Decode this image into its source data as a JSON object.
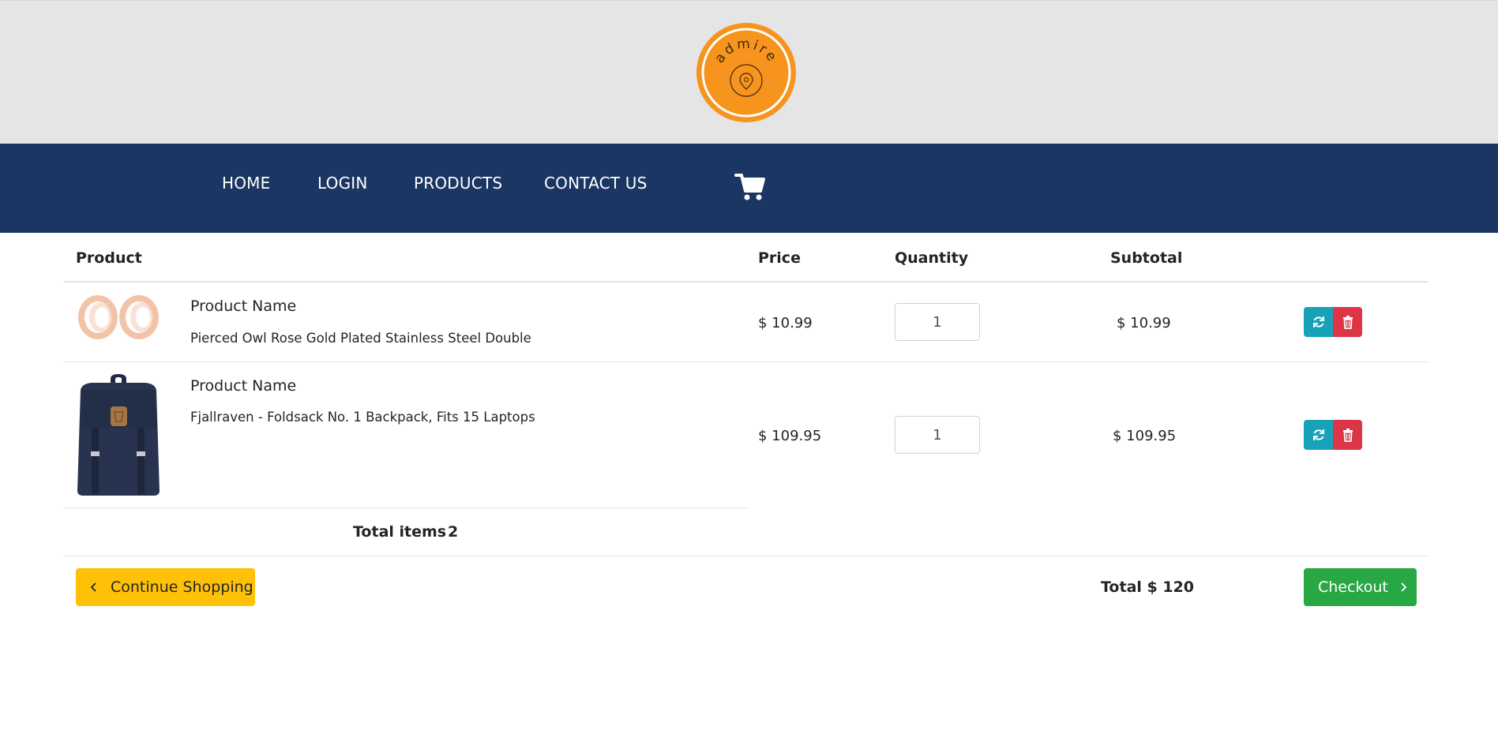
{
  "brand": {
    "logo_text": "admire"
  },
  "nav": {
    "items": [
      {
        "label": "HOME"
      },
      {
        "label": "LOGIN"
      },
      {
        "label": "PRODUCTS"
      },
      {
        "label": "CONTACT US"
      }
    ],
    "cart_icon": "shopping-cart-icon"
  },
  "table": {
    "headers": {
      "product": "Product",
      "price": "Price",
      "quantity": "Quantity",
      "subtotal": "Subtotal"
    },
    "rows": [
      {
        "label": "Product Name",
        "name": "Pierced Owl Rose Gold Plated Stainless Steel Double",
        "price": "$ 10.99",
        "quantity": "1",
        "subtotal": "$ 10.99",
        "image": "rose-gold-ear-tunnels"
      },
      {
        "label": "Product Name",
        "name": "Fjallraven - Foldsack No. 1 Backpack, Fits 15 Laptops",
        "price": "$ 109.95",
        "quantity": "1",
        "subtotal": "$ 109.95",
        "image": "navy-backpack"
      }
    ],
    "actions": {
      "update_icon": "refresh-icon",
      "delete_icon": "trash-icon"
    }
  },
  "summary": {
    "total_items_label": "Total items",
    "total_items_value": "2",
    "total_label": "Total $ 120"
  },
  "buttons": {
    "continue_label": "Continue Shopping",
    "checkout_label": "Checkout"
  },
  "colors": {
    "banner": "#e5e5e5",
    "navbar": "#1b3663",
    "logo": "#f7941d",
    "refresh": "#17a2b8",
    "delete": "#dc3545",
    "continue": "#ffc107",
    "checkout": "#28a745"
  }
}
